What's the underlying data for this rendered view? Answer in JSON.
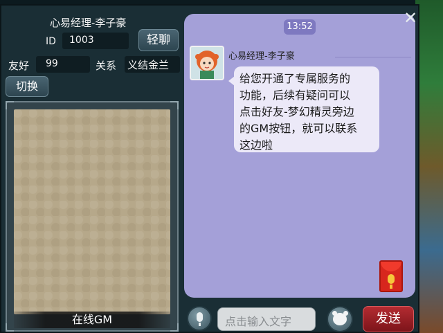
{
  "contact": {
    "name": "心易经理-李子豪",
    "id_label": "ID",
    "id_value": "1003",
    "chat_button": "轻聊",
    "friendship_label": "友好",
    "friendship_value": "99",
    "relation_label": "关系",
    "relation_value": "义结金兰",
    "switch_button": "切换",
    "online_status": "在线GM"
  },
  "chat": {
    "timestamp": "13:52",
    "messages": [
      {
        "sender": "心易经理-李子豪",
        "lines": [
          "给您开通了专属服务的",
          "功能，后续有疑问可以",
          "点击好友-梦幻精灵旁边",
          "的GM按钮，就可以联系",
          "这边啦"
        ]
      }
    ]
  },
  "input_bar": {
    "placeholder": "点击输入文字",
    "send_button": "发送"
  },
  "icons": {
    "close": "close-icon",
    "voice": "microphone-icon",
    "emoji": "emoji-icon",
    "red_packet": "red-packet-voice-icon"
  },
  "colors": {
    "chat_background": "#a4a0d8",
    "bubble": "#ece9f8",
    "send_button": "#b42b31",
    "panel": "#1a2e35"
  }
}
